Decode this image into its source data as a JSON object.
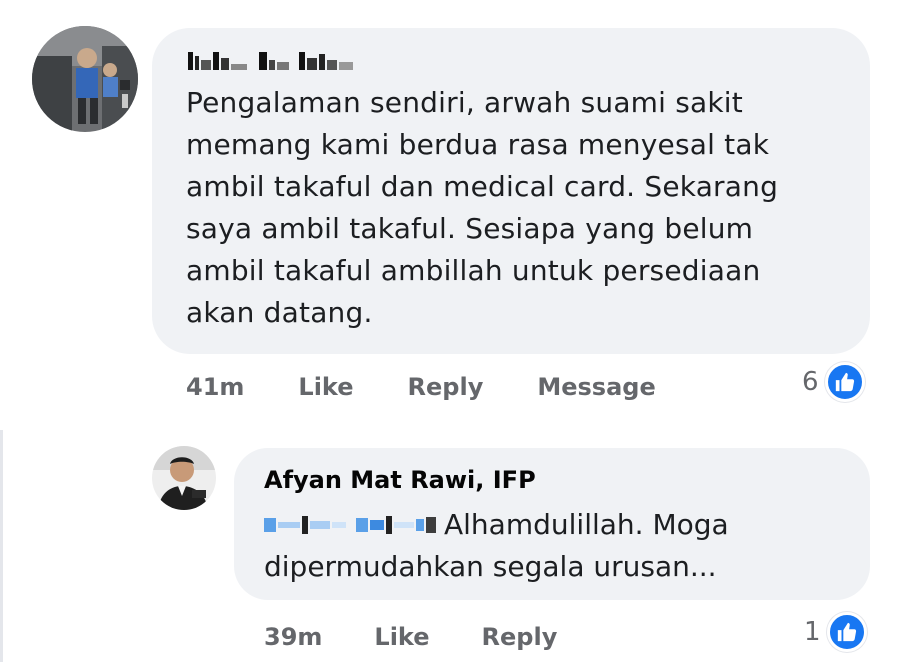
{
  "comment1": {
    "text_lines": [
      "Pengalaman sendiri, arwah suami sakit",
      "memang kami berdua rasa menyesal tak",
      "ambil takaful dan medical card. Sekarang",
      "saya ambil takaful. Sesiapa yang belum",
      "ambil takaful ambillah untuk persediaan",
      "akan datang."
    ],
    "time": "41m",
    "like_label": "Like",
    "reply_label": "Reply",
    "message_label": "Message",
    "reaction_count": "6"
  },
  "comment2": {
    "author": "Afyan Mat Rawi, IFP",
    "text_line1": "Alhamdulillah. Moga",
    "text_line2": "dipermudahkan segala urusan...",
    "time": "39m",
    "like_label": "Like",
    "reply_label": "Reply",
    "reaction_count": "1"
  },
  "colors": {
    "bubble": "#f0f2f5",
    "action_text": "#65676b",
    "like_blue": "#1877f2",
    "mention_blue": "#5aa0e8"
  },
  "icons": [
    "avatar-photo",
    "like-reaction-icon"
  ]
}
